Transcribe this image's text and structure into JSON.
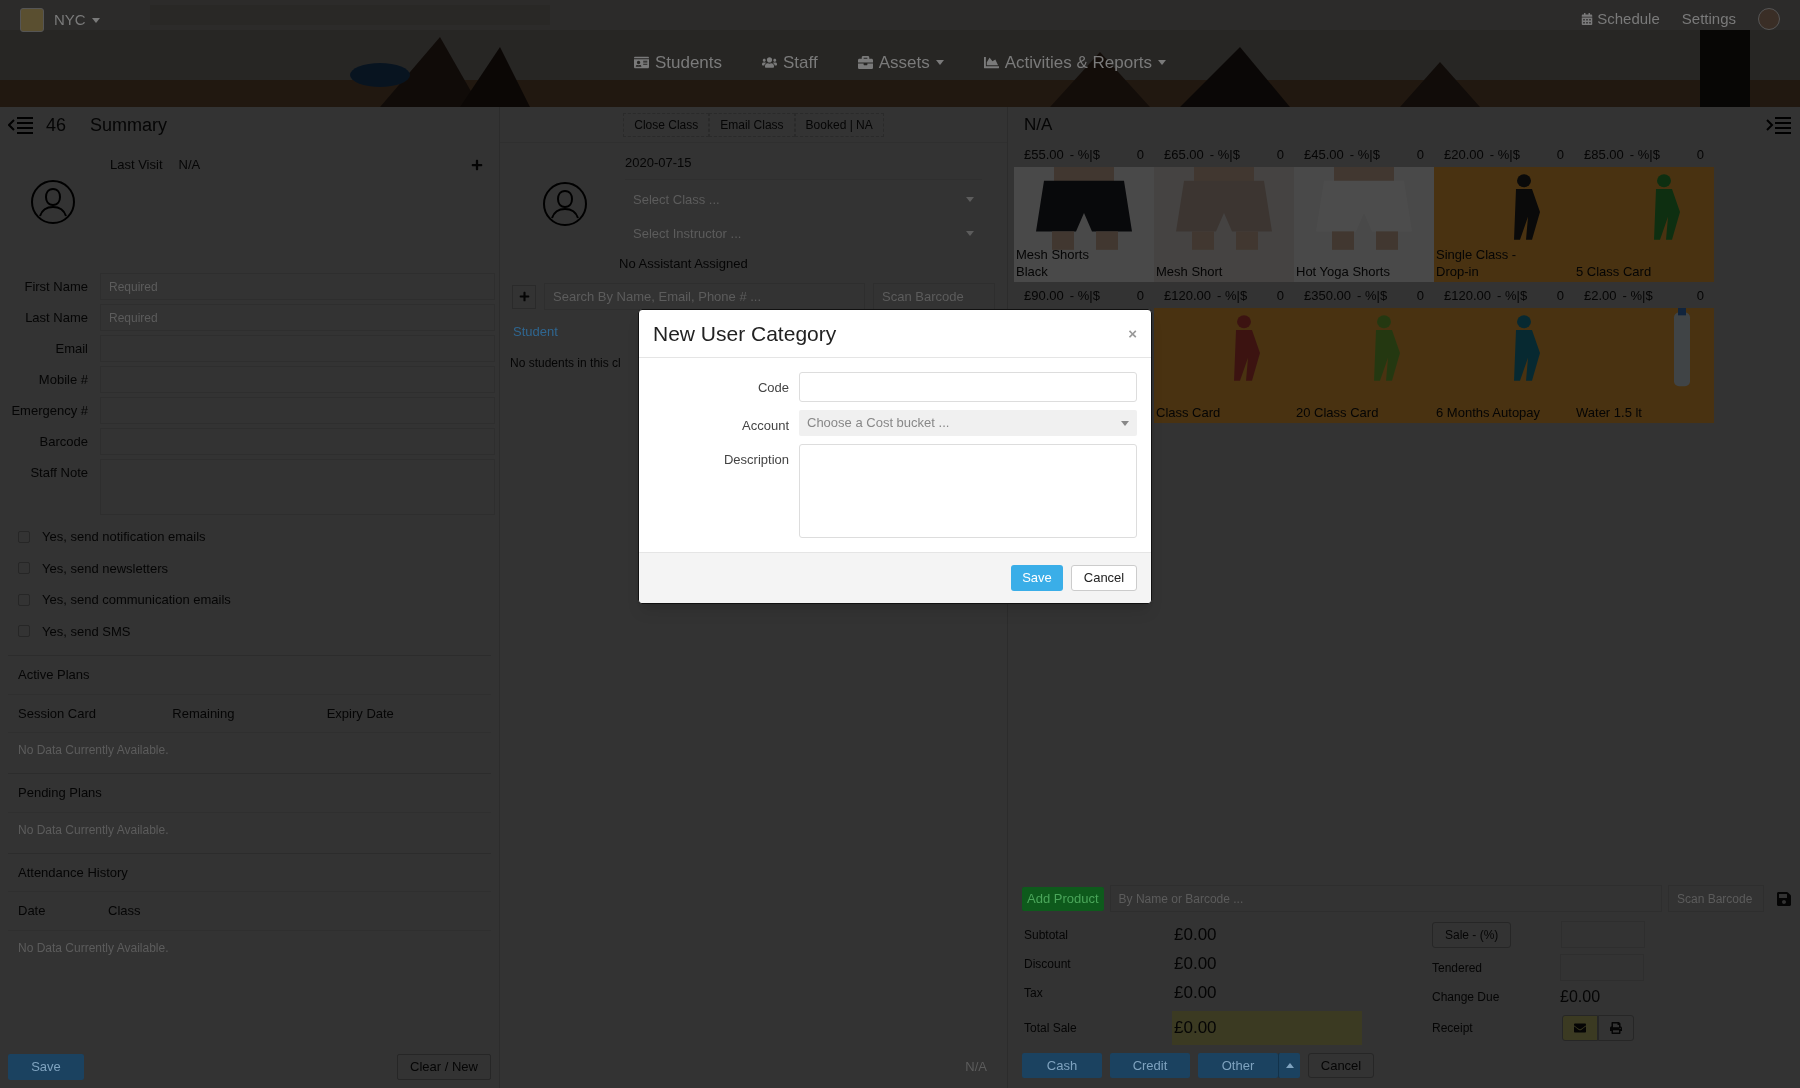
{
  "header": {
    "brand": "NYC",
    "nav": [
      {
        "label": "Students",
        "dropdown": false
      },
      {
        "label": "Staff",
        "dropdown": false
      },
      {
        "label": "Assets",
        "dropdown": true
      },
      {
        "label": "Activities & Reports",
        "dropdown": true
      }
    ],
    "schedule": "Schedule",
    "settings": "Settings"
  },
  "summary": {
    "count": "46",
    "title": "Summary",
    "last_visit_label": "Last Visit",
    "last_visit_value": "N/A",
    "fields": [
      {
        "label": "First Name",
        "placeholder": "Required",
        "kind": "input"
      },
      {
        "label": "Last Name",
        "placeholder": "Required",
        "kind": "input"
      },
      {
        "label": "Email",
        "kind": "input"
      },
      {
        "label": "Mobile #",
        "kind": "input"
      },
      {
        "label": "Emergency #",
        "kind": "input"
      },
      {
        "label": "Barcode",
        "kind": "input"
      },
      {
        "label": "Staff Note",
        "kind": "textarea"
      }
    ],
    "options": [
      {
        "label": "Yes, send notification emails",
        "checked": false
      },
      {
        "label": "Yes, send newsletters",
        "checked": false
      },
      {
        "label": "Yes, send communication emails",
        "checked": false
      },
      {
        "label": "Yes, send SMS",
        "checked": false
      }
    ],
    "sections": [
      {
        "title": "Active Plans",
        "columns": [
          "Session Card",
          "Remaining",
          "Expiry Date"
        ],
        "empty": "No Data Currently Available."
      },
      {
        "title": "Pending Plans",
        "empty": "No Data Currently Available."
      },
      {
        "title": "Attendance History",
        "columns": [
          "Date",
          "Class"
        ],
        "empty": "No Data Currently Available."
      }
    ],
    "save": "Save",
    "clear": "Clear / New"
  },
  "class_panel": {
    "actions": [
      "Close Class",
      "Email Class",
      "Booked | NA"
    ],
    "date": "2020-07-15",
    "class_placeholder": "Select Class ...",
    "instructor_placeholder": "Select Instructor ...",
    "assistant": "No Assistant Assigned",
    "search_placeholder": "Search By Name, Email, Phone # ...",
    "scan_placeholder": "Scan Barcode",
    "tab": "Student",
    "empty": "No students in this cl",
    "footer": "N/A"
  },
  "pos": {
    "title": "N/A",
    "products": [
      {
        "price": "£55.00",
        "discount": "- %|$",
        "qty": "0",
        "name": "Mesh Shorts Black",
        "kind": "picture"
      },
      {
        "price": "£65.00",
        "discount": "- %|$",
        "qty": "0",
        "name": "Mesh Short",
        "kind": "picture"
      },
      {
        "price": "£45.00",
        "discount": "- %|$",
        "qty": "0",
        "name": "Hot Yoga Shorts",
        "kind": "picture"
      },
      {
        "price": "£20.00",
        "discount": "- %|$",
        "qty": "0",
        "name": "Single Class - Drop-in",
        "kind": "picture"
      },
      {
        "price": "£85.00",
        "discount": "- %|$",
        "qty": "0",
        "name": "5 Class Card",
        "kind": "picture"
      },
      {
        "price": "£90.00",
        "discount": "- %|$",
        "qty": "0"
      },
      {
        "price": "£120.00",
        "discount": "- %|$",
        "qty": "0",
        "name": "Class Card",
        "kind": "picture"
      },
      {
        "price": "£350.00",
        "discount": "- %|$",
        "qty": "0",
        "name": "20 Class Card",
        "kind": "picture"
      },
      {
        "price": "£120.00",
        "discount": "- %|$",
        "qty": "0",
        "name": "6 Months Autopay",
        "kind": "picture"
      },
      {
        "price": "£2.00",
        "discount": "- %|$",
        "qty": "0",
        "name": "Water 1.5 lt",
        "kind": "picture"
      }
    ],
    "add_product": "Add Product",
    "search_placeholder": "By Name or Barcode ...",
    "scan_placeholder": "Scan Barcode",
    "totals": [
      {
        "label": "Subtotal",
        "value": "£0.00"
      },
      {
        "label": "Discount",
        "value": "£0.00"
      },
      {
        "label": "Tax",
        "value": "£0.00"
      },
      {
        "label": "Total Sale",
        "value": "£0.00"
      }
    ],
    "sale_button": "Sale - (%)",
    "tendered": "Tendered",
    "change_due": "Change Due",
    "change_value": "£0.00",
    "receipt": "Receipt",
    "pay_buttons": [
      "Cash",
      "Credit",
      "Other"
    ],
    "cancel": "Cancel"
  },
  "dialog": {
    "title": "New User Category",
    "close": "×",
    "fields": [
      {
        "label": "Code",
        "kind": "input"
      },
      {
        "label": "Account",
        "kind": "select",
        "placeholder": "Choose a Cost bucket ..."
      },
      {
        "label": "Description",
        "kind": "textarea"
      }
    ],
    "save": "Save",
    "cancel": "Cancel"
  }
}
